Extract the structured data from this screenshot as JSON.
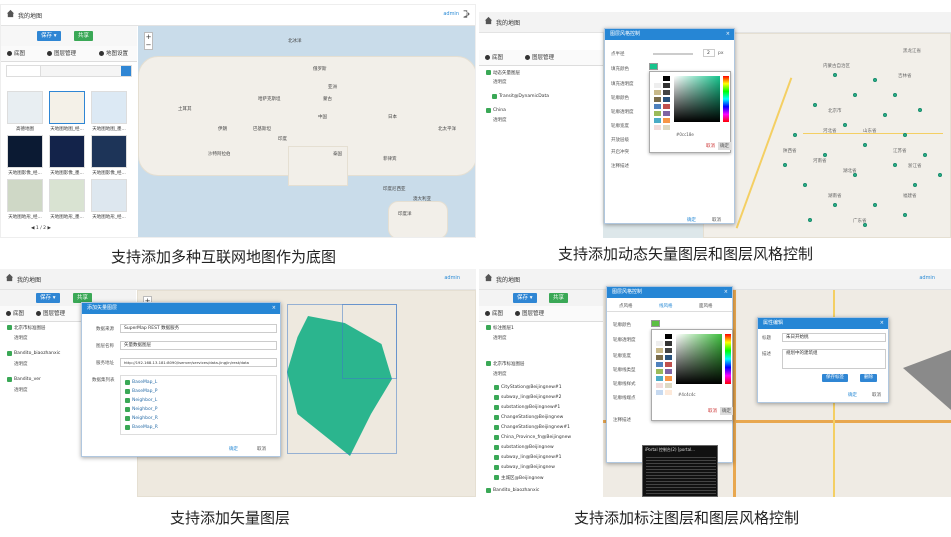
{
  "app": {
    "title": "我的地图",
    "user": "admin"
  },
  "toolbar": {
    "save": "保存",
    "share": "共享"
  },
  "captions": [
    "支持添加多种互联网地图作为底图",
    "支持添加动态矢量图层和图层风格控制",
    "支持添加矢量图层",
    "支持添加标注图层和图层风格控制"
  ],
  "panel1": {
    "tabs": [
      "底图",
      "图层管理",
      "地图设置"
    ],
    "thumbs": [
      "高德地图",
      "天地图地图_经...",
      "天地图地图_墨...",
      "天地图影像_经...",
      "天地图影像_墨...",
      "天地图影像_经...",
      "天地图地形_经...",
      "天地图地形_墨...",
      "天地图地形_经..."
    ],
    "pager": "1 / 2",
    "map_labels": [
      "亚洲",
      "印度洋",
      "北冰洋",
      "俄罗斯",
      "中国",
      "蒙古",
      "印度",
      "澳大利亚",
      "哈萨克斯坦",
      "伊朗",
      "土耳其",
      "沙特阿拉伯",
      "巴基斯坦",
      "日本",
      "印度尼西亚",
      "菲律宾",
      "北太平洋",
      "泰国"
    ]
  },
  "panel2": {
    "tabs": [
      "底图",
      "图层管理"
    ],
    "layers": [
      "动态矢量图层",
      "透明度",
      "Transit@DynamicData",
      "China",
      "透明度"
    ],
    "dialog": {
      "title": "图层风格控制",
      "fields": [
        "点半径",
        "填充颜色",
        "填充透明度",
        "轮廓颜色",
        "轮廓透明度",
        "轮廓宽度",
        "开放层级",
        "开启冲突",
        "注释描述"
      ],
      "radius_unit": "px",
      "radius_value": "2",
      "ok": "确定",
      "cancel": "取消",
      "palette_ok": "确定",
      "palette_cancel": "取消",
      "hex": "#0cc18e"
    },
    "map_labels": [
      "黑龙江省",
      "吉林省",
      "内蒙古自治区",
      "北京市",
      "河北省",
      "山东省",
      "河南省",
      "江苏省",
      "湖北省",
      "浙江省",
      "福建省",
      "湖南省",
      "广东省",
      "陕西省"
    ]
  },
  "panel3": {
    "tabs": [
      "底图",
      "图层管理"
    ],
    "layers": [
      "北京市标准图层",
      "透明度",
      "Bandito_biaozhanxic",
      "透明度",
      "Bandito_ver",
      "透明度"
    ],
    "dialog": {
      "title": "添加矢量图层",
      "source_label": "数据来源",
      "source_value": "SuperMap REST 数据服务",
      "name_label": "图层名称",
      "name_value": "矢量数据图层",
      "url_label": "服务地址",
      "url_value": "http://192.168.13.181:8090/iserver/services/data-jingjin/rest/data",
      "set_label": "数据集列表",
      "datasets": [
        "BaseMap_L",
        "BaseMap_P",
        "Neighbor_L",
        "Neighbor_P",
        "Neighbor_R",
        "BaseMap_R"
      ],
      "ok": "确定",
      "cancel": "取消"
    }
  },
  "panel4": {
    "tabs": [
      "底图",
      "图层管理"
    ],
    "layers": [
      "标注图层1",
      "透明度",
      "北京市标准图层",
      "透明度",
      "CityStation@Beijingnew#1",
      "subway_lin@Beijingnew#2",
      "substation@Beijingnew#1",
      "ChangeStation@Beijingnew",
      "ChangeStation@Beijingnew#1",
      "China_Province_fn@Beijingnew",
      "substation@Beijingnew",
      "subway_lin@Beijingnew#1",
      "subway_lin@Beijingnew",
      "主城区@Beijingnew",
      "Bandito_biaozhanxic"
    ],
    "style_dialog": {
      "title": "图层风格控制",
      "tabs": [
        "点风格",
        "线风格",
        "面风格"
      ],
      "fields": [
        "轮廓颜色",
        "轮廓透明度",
        "轮廓宽度",
        "轮廓线类型",
        "轮廓线样式",
        "轮廓线端点",
        "注释描述"
      ],
      "hex": "#4c4c4c",
      "ok": "确定",
      "cancel": "取消",
      "palette_ok": "确定",
      "palette_cancel": "取消"
    },
    "attr_dialog": {
      "title": "属性编辑",
      "name_label": "标题",
      "name_value": "朱日开始桃",
      "desc_label": "描述",
      "desc_value": "规划中的建筑组",
      "save": "保存标签",
      "delete": "删除",
      "ok": "确定",
      "cancel": "取消"
    },
    "terminal": "iPortal 控制台(2) [portal..."
  }
}
